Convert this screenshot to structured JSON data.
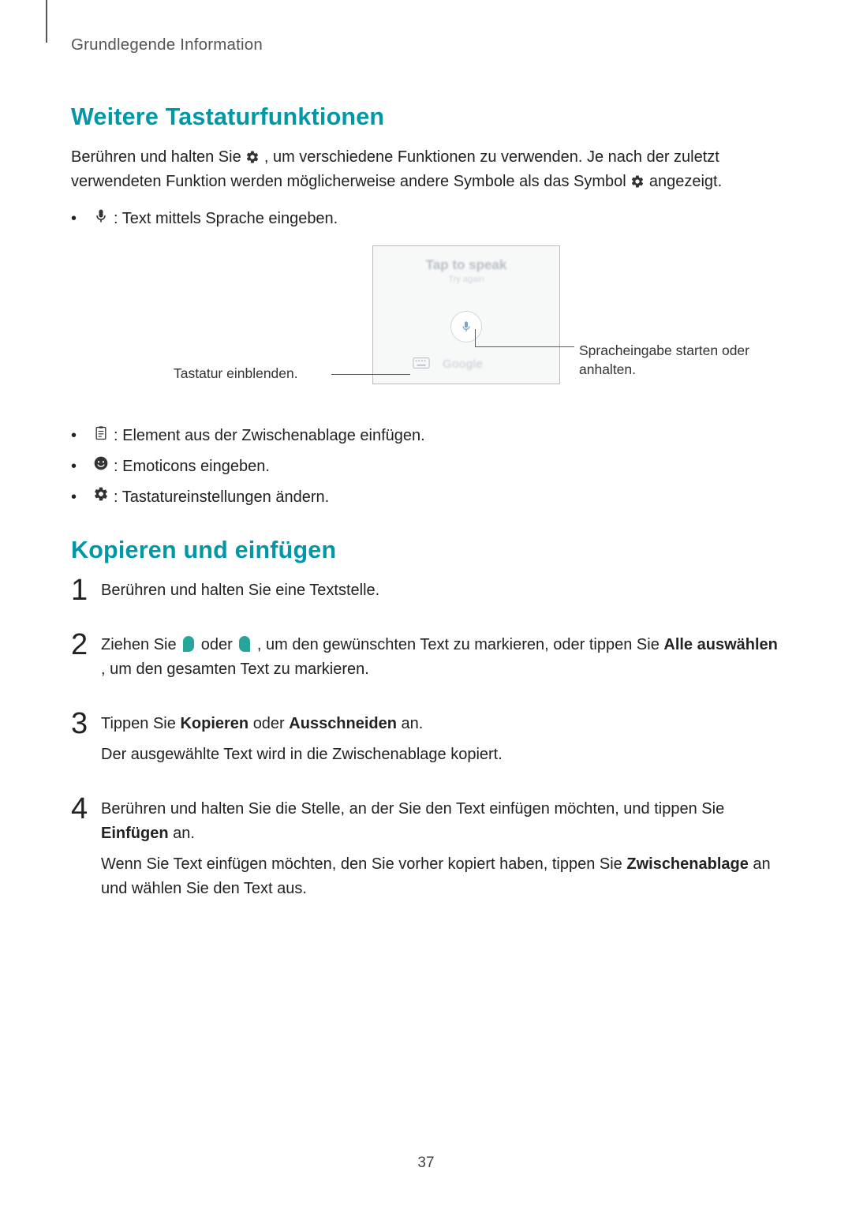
{
  "page": {
    "running_head": "Grundlegende Information",
    "number": "37"
  },
  "section1": {
    "title": "Weitere Tastaturfunktionen",
    "intro_part1": "Berühren und halten Sie ",
    "intro_part2": ", um verschiedene Funktionen zu verwenden. Je nach der zuletzt verwendeten Funktion werden möglicherweise andere Symbole als das Symbol ",
    "intro_part3": " angezeigt.",
    "bullets": {
      "mic": " : Text mittels Sprache eingeben.",
      "clipboard": " : Element aus der Zwischenablage einfügen.",
      "emoji": " : Emoticons eingeben.",
      "settings": " : Tastatureinstellungen ändern."
    },
    "figure": {
      "tap_to_speak": "Tap to speak",
      "try_again": "Try again",
      "google": "Google",
      "callout_left": "Tastatur einblenden.",
      "callout_right": "Spracheingabe starten oder anhalten."
    }
  },
  "section2": {
    "title": "Kopieren und einfügen",
    "step1": "Berühren und halten Sie eine Textstelle.",
    "step2_a": "Ziehen Sie ",
    "step2_b": " oder ",
    "step2_c": ", um den gewünschten Text zu markieren, oder tippen Sie ",
    "step2_bold1": "Alle auswählen",
    "step2_d": ", um den gesamten Text zu markieren.",
    "step3_a": "Tippen Sie ",
    "step3_bold1": "Kopieren",
    "step3_b": " oder ",
    "step3_bold2": "Ausschneiden",
    "step3_c": " an.",
    "step3_sub": "Der ausgewählte Text wird in die Zwischenablage kopiert.",
    "step4_a": "Berühren und halten Sie die Stelle, an der Sie den Text einfügen möchten, und tippen Sie ",
    "step4_bold1": "Einfügen",
    "step4_b": " an.",
    "step4_sub_a": "Wenn Sie Text einfügen möchten, den Sie vorher kopiert haben, tippen Sie ",
    "step4_sub_bold": "Zwischenablage",
    "step4_sub_b": " an und wählen Sie den Text aus."
  }
}
